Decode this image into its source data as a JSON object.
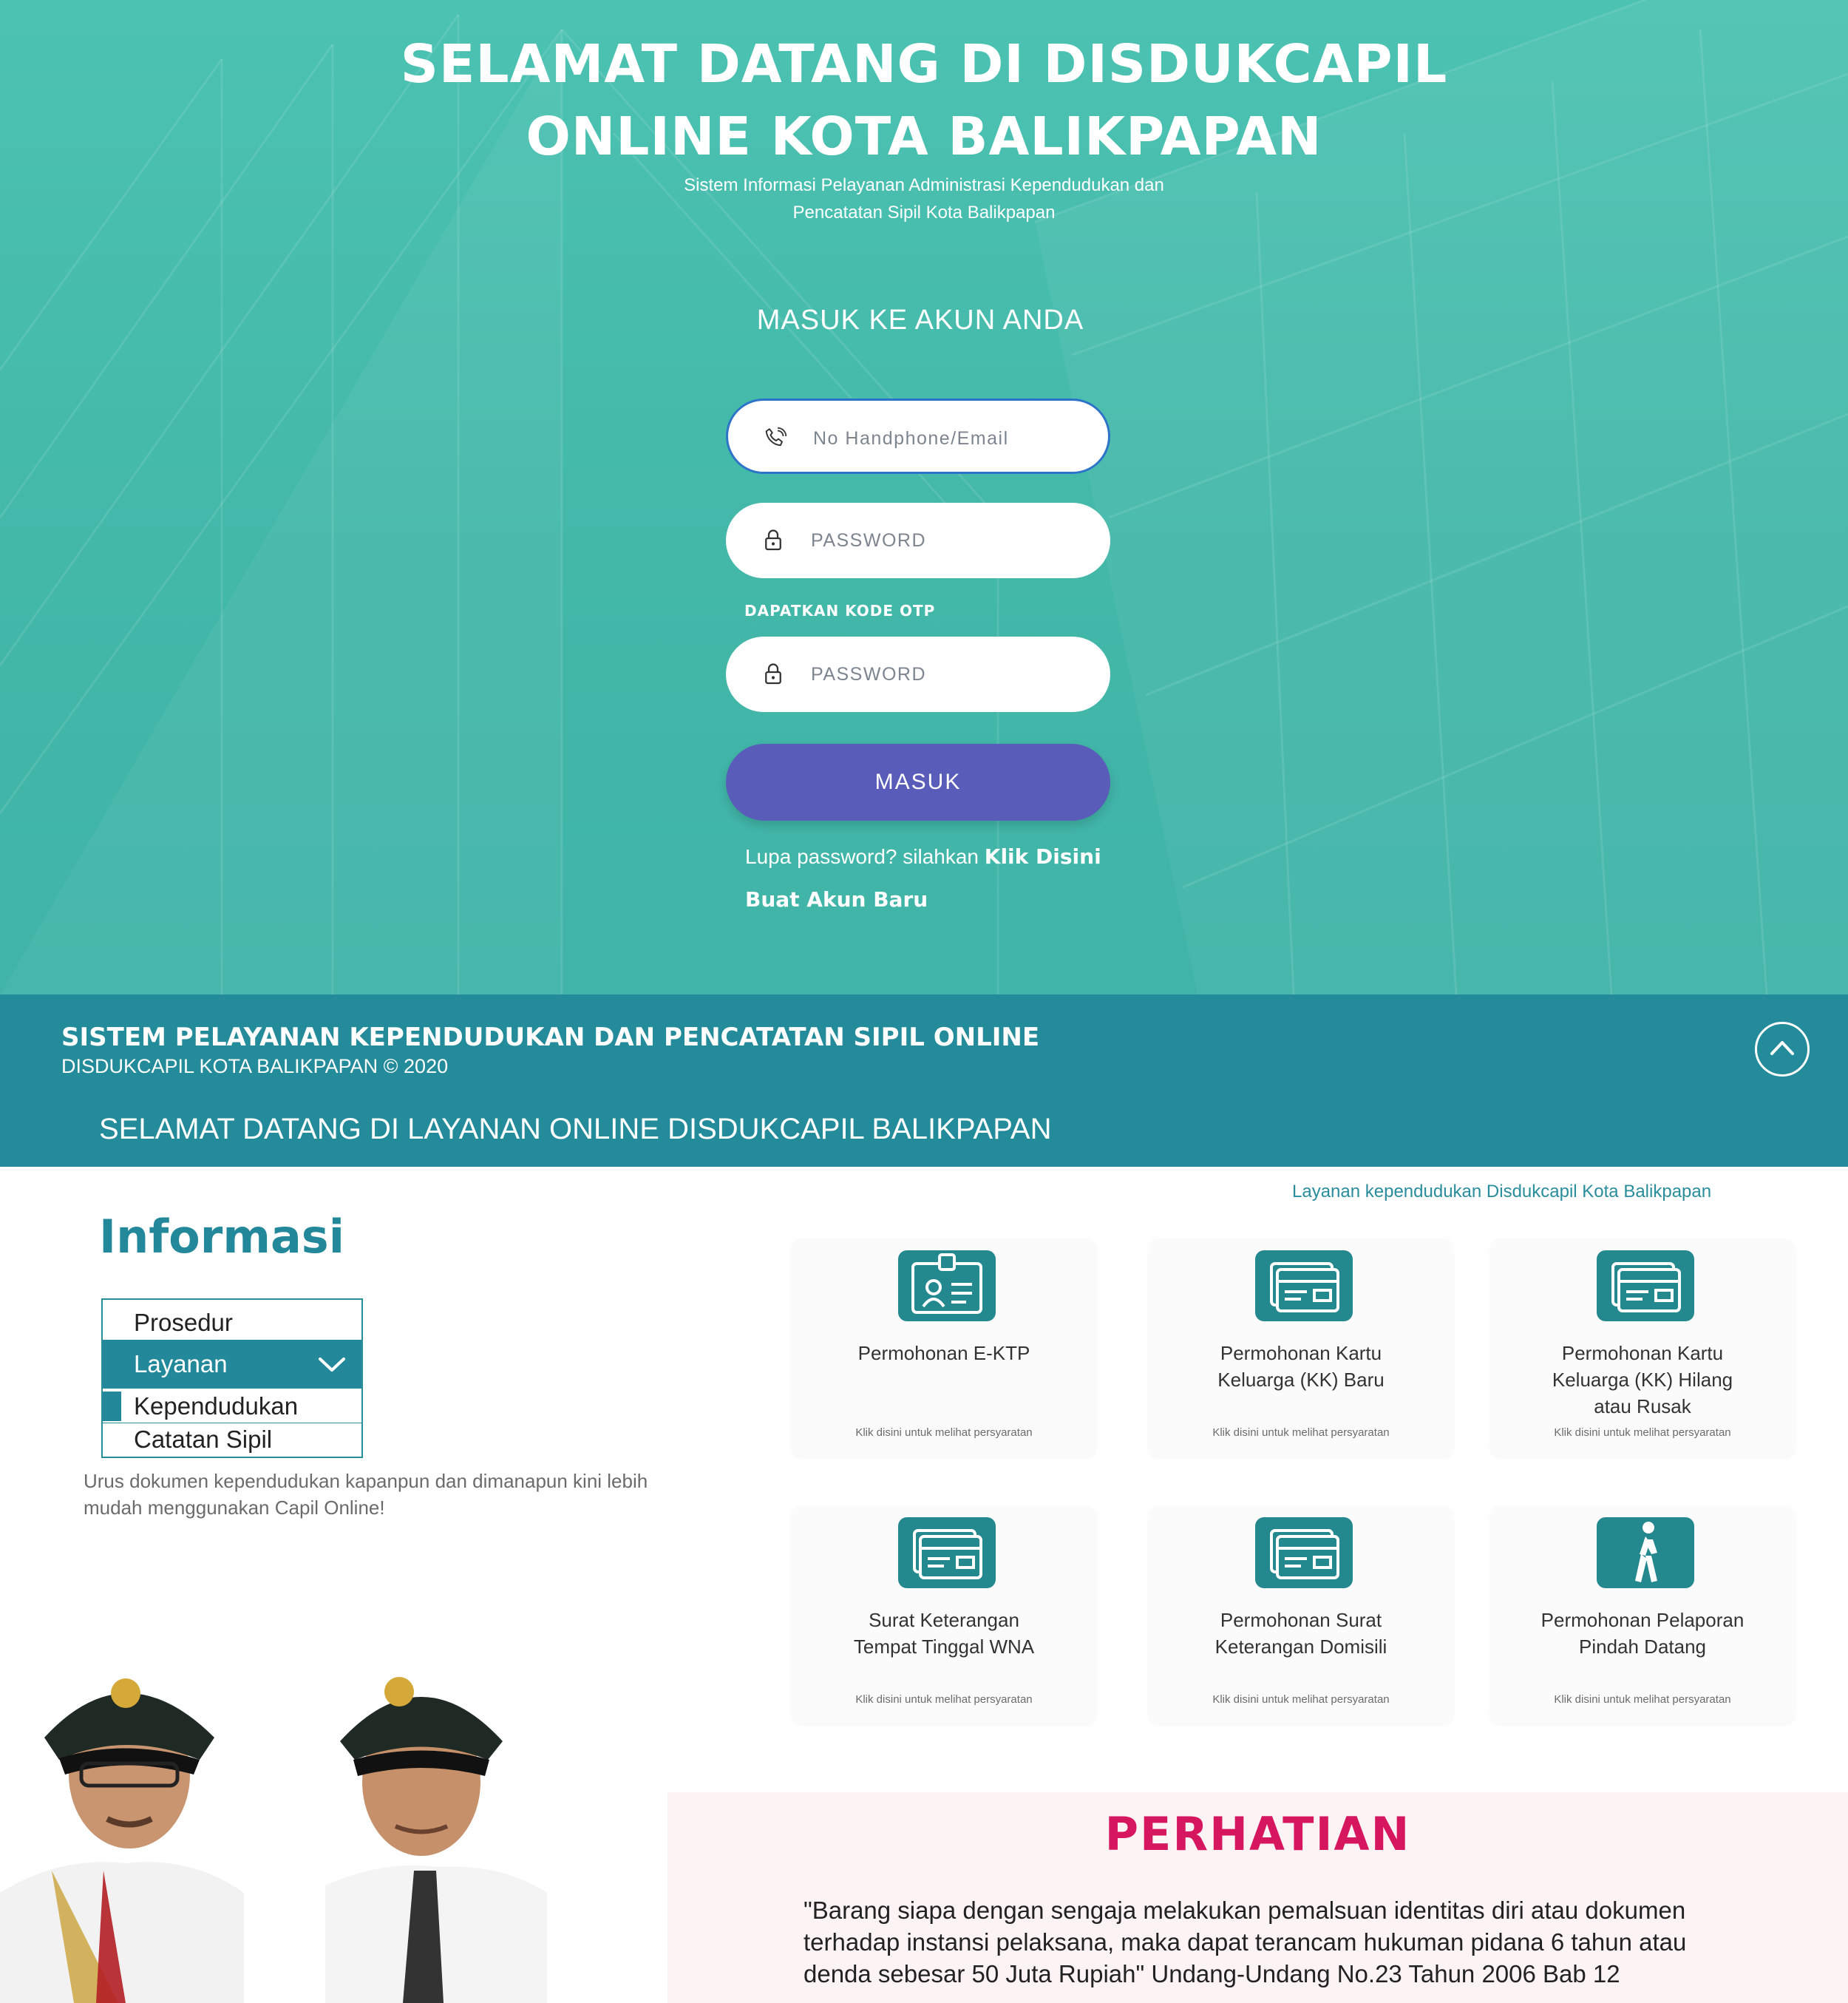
{
  "hero": {
    "title_line1": "SELAMAT DATANG DI DISDUKCAPIL",
    "title_line2": "ONLINE KOTA BALIKPAPAN",
    "subtitle_line1": "Sistem Informasi Pelayanan Administrasi Kependudukan dan",
    "subtitle_line2": "Pencatatan Sipil Kota Balikpapan"
  },
  "login": {
    "heading": "MASUK KE AKUN ANDA",
    "phone_placeholder": "No Handphone/Email",
    "password_placeholder": "PASSWORD",
    "otp_link": "DAPATKAN KODE OTP",
    "otp_placeholder": "PASSWORD",
    "submit_label": "MASUK",
    "forgot_text": "Lupa password? silahkan",
    "forgot_link": "Klik Disini",
    "register_link": "Buat Akun Baru",
    "icons": {
      "phone": "phone-icon",
      "lock": "lock-icon"
    }
  },
  "band": {
    "title": "SISTEM PELAYANAN KEPENDUDUKAN DAN PENCATATAN SIPIL ONLINE",
    "copyright": "DISDUKCAPIL KOTA BALIKPAPAN © 2020",
    "welcome": "SELAMAT DATANG DI LAYANAN ONLINE DISDUKCAPIL BALIKPAPAN",
    "scroll_icon": "chevron-up-icon"
  },
  "info": {
    "title": "Informasi",
    "menu": [
      {
        "label": "Prosedur"
      },
      {
        "label": "Layanan"
      },
      {
        "label": "Kependudukan"
      },
      {
        "label": "Catatan Sipil"
      }
    ],
    "description": "Urus dokumen kependudukan kapanpun dan dimanapun kini lebih mudah menggunakan Capil Online!"
  },
  "services": {
    "caption": "Layanan kependudukan Disdukcapil Kota Balikpapan",
    "link_text": "Klik disini untuk melihat persyaratan",
    "cards": [
      {
        "line1": "Permohonan E-KTP",
        "line2": "",
        "line3": "",
        "icon": "id-card-icon"
      },
      {
        "line1": "Permohonan Kartu",
        "line2": "Keluarga (KK) Baru",
        "line3": "",
        "icon": "card-icon"
      },
      {
        "line1": "Permohonan Kartu",
        "line2": "Keluarga (KK) Hilang",
        "line3": "atau Rusak",
        "icon": "card-icon"
      },
      {
        "line1": "Surat Keterangan",
        "line2": "Tempat Tinggal WNA",
        "line3": "",
        "icon": "card-icon"
      },
      {
        "line1": "Permohonan Surat",
        "line2": "Keterangan Domisili",
        "line3": "",
        "icon": "card-icon"
      },
      {
        "line1": "Permohonan Pelaporan",
        "line2": "Pindah Datang",
        "line3": "",
        "icon": "walking-person-icon"
      }
    ]
  },
  "attention": {
    "title": "PERHATIAN",
    "line1": "\"Barang siapa dengan sengaja melakukan pemalsuan identitas diri atau dokumen",
    "line2": "terhadap instansi pelaksana, maka dapat terancam hukuman pidana 6 tahun atau",
    "line3": "denda sebesar 50 Juta Rupiah\" Undang-Undang No.23 Tahun 2006 Bab 12"
  },
  "colors": {
    "hero_teal": "#43b8a9",
    "band_teal": "#238b99",
    "button_purple": "#5a5cba",
    "accent_teal": "#23899a",
    "attention_red": "#d6175f"
  }
}
